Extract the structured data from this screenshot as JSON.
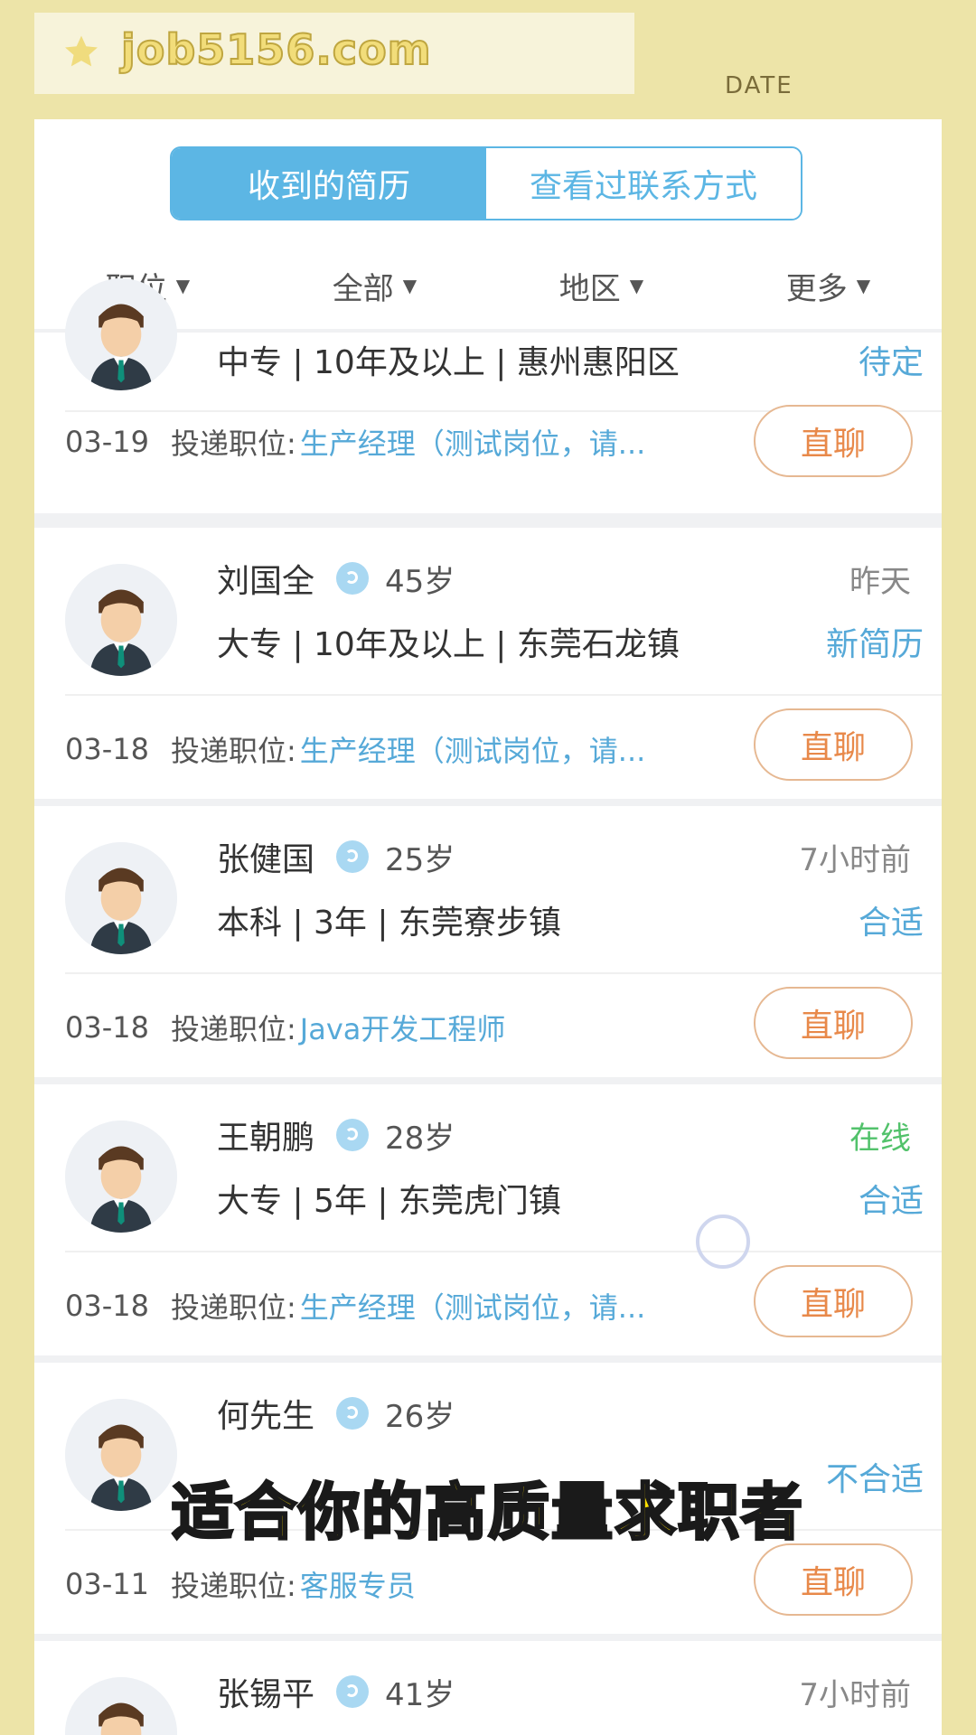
{
  "browser": {
    "site": "job5156.com",
    "date_label": "DATE"
  },
  "tabs": [
    {
      "label": "收到的简历",
      "active": true
    },
    {
      "label": "查看过联系方式",
      "active": false
    }
  ],
  "filters": [
    "职位",
    "全部",
    "地区",
    "更多"
  ],
  "chat_label": "直聊",
  "apply_label": "投递职位:",
  "cards": [
    {
      "name": "",
      "age": "",
      "time": "",
      "info": "中专 | 10年及以上 | 惠州惠阳区",
      "status": "待定",
      "date": "03-19",
      "position": "生产经理（测试岗位，请..."
    },
    {
      "name": "刘国全",
      "age": "45岁",
      "time": "昨天",
      "info": "大专 | 10年及以上 | 东莞石龙镇",
      "status": "新简历",
      "date": "03-18",
      "position": "生产经理（测试岗位，请..."
    },
    {
      "name": "张健国",
      "age": "25岁",
      "time": "7小时前",
      "info": "本科 | 3年 | 东莞寮步镇",
      "status": "合适",
      "date": "03-18",
      "position": "Java开发工程师"
    },
    {
      "name": "王朝鹏",
      "age": "28岁",
      "time": "在线",
      "info": "大专 | 5年 | 东莞虎门镇",
      "status": "合适",
      "date": "03-18",
      "position": "生产经理（测试岗位，请..."
    },
    {
      "name": "何先生",
      "age": "26岁",
      "time": "",
      "info": "",
      "status": "不合适",
      "date": "03-11",
      "position": "客服专员"
    },
    {
      "name": "张锡平",
      "age": "41岁",
      "time": "7小时前",
      "info": "",
      "status": "",
      "date": "",
      "position": ""
    }
  ],
  "subtitle": "适合你的高质量求职者",
  "colors": {
    "accent": "#5cb6e4",
    "online": "#52c26b",
    "chat": "#e8894a",
    "background": "#ede4a8"
  }
}
